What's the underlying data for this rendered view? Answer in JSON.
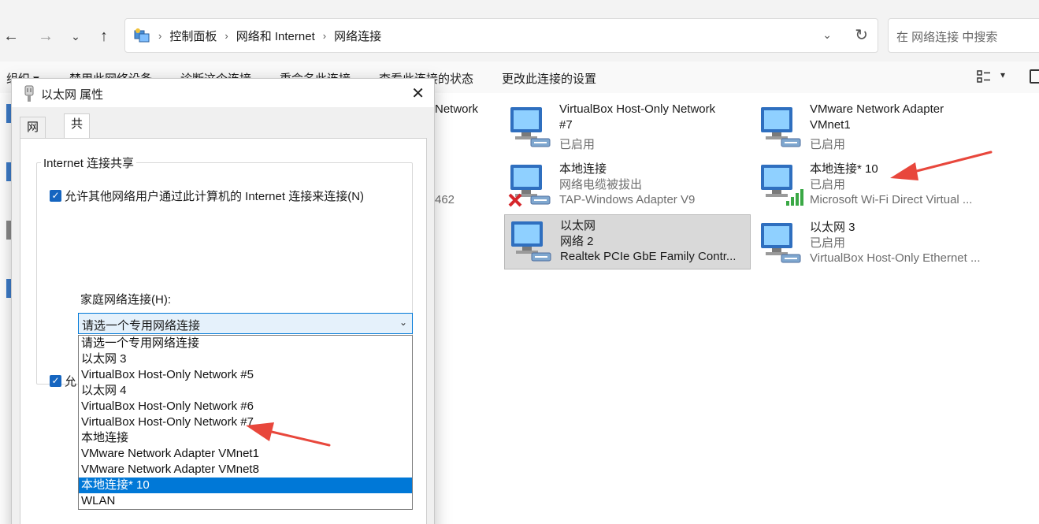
{
  "nav": {
    "back_icon": "arrow-left-icon",
    "forward_icon": "arrow-right-icon",
    "recent_icon": "chevron-down-icon",
    "up_icon": "arrow-up-icon"
  },
  "address": {
    "crumbs": [
      "控制面板",
      "网络和 Internet",
      "网络连接"
    ],
    "separator": "›",
    "refresh_icon": "refresh-icon"
  },
  "search": {
    "placeholder": "在 网络连接 中搜索"
  },
  "commands": [
    "组织 ▾",
    "禁用此网络设备",
    "诊断这个连接",
    "重命名此连接",
    "查看此连接的状态",
    "更改此连接的设置"
  ],
  "partial_texts": [
    "Network",
    "462"
  ],
  "adapters": [
    {
      "name": "VirtualBox Host-Only Network",
      "line2": "#7",
      "line3": "已启用",
      "status": "enabled"
    },
    {
      "name": "VMware Network Adapter",
      "line2": "VMnet1",
      "line3": "已启用",
      "status": "enabled"
    },
    {
      "name": "本地连接",
      "line2": "网络电缆被拔出",
      "line3": "TAP-Windows Adapter V9",
      "status": "disconnected"
    },
    {
      "name": "本地连接* 10",
      "line2": "已启用",
      "line3": "Microsoft Wi-Fi Direct Virtual ...",
      "status": "wireless"
    },
    {
      "name": "以太网",
      "line2": "网络 2",
      "line3": "Realtek PCIe GbE Family Contr...",
      "status": "selected"
    },
    {
      "name": "以太网 3",
      "line2": "已启用",
      "line3": "VirtualBox Host-Only Ethernet ...",
      "status": "enabled"
    }
  ],
  "dialog": {
    "title": "以太网 属性",
    "tabs": [
      "网络",
      "共享"
    ],
    "group_title": "Internet 连接共享",
    "allow_checkbox": "允许其他网络用户通过此计算机的 Internet 连接来连接(N)",
    "second_checkbox_partial": "允",
    "home_label": "家庭网络连接(H):",
    "combo_value": "请选一个专用网络连接",
    "options": [
      "请选一个专用网络连接",
      "以太网 3",
      "VirtualBox Host-Only Network #5",
      "以太网 4",
      "VirtualBox Host-Only Network #6",
      "VirtualBox Host-Only Network #7",
      "本地连接",
      "VMware Network Adapter VMnet1",
      "VMware Network Adapter VMnet8",
      "本地连接* 10",
      "WLAN"
    ],
    "selected_option_index": 9
  },
  "colors": {
    "accent": "#0078d7",
    "checkbox": "#1565c0",
    "arrow": "#e8473c",
    "selected_bg": "#d9d9d9"
  }
}
